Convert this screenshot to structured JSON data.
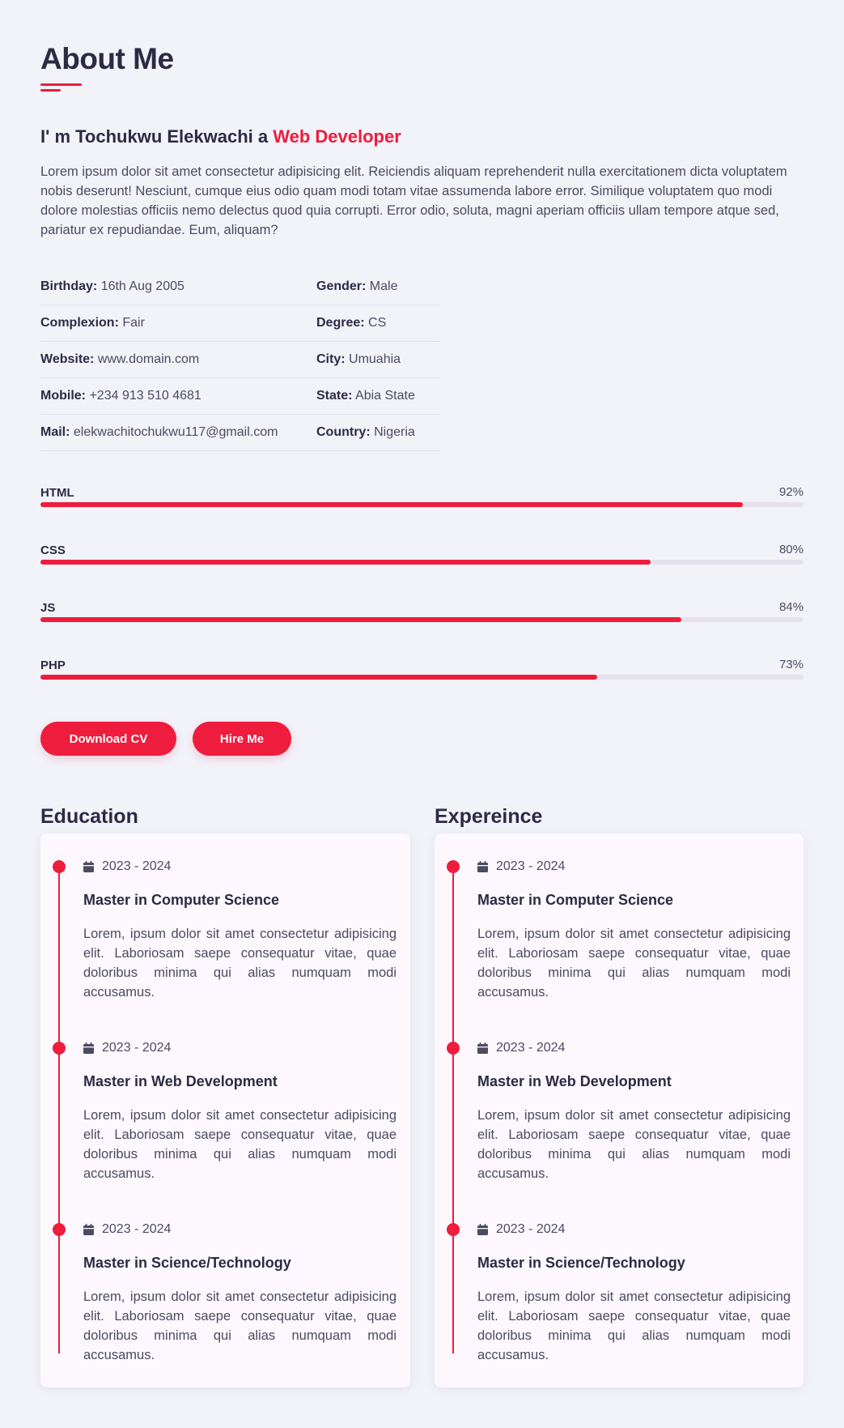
{
  "about": {
    "title": "About Me",
    "intro_prefix": "I' m Tochukwu Elekwachi a ",
    "intro_role": "Web Developer",
    "paragraph": "Lorem ipsum dolor sit amet consectetur adipisicing elit. Reiciendis aliquam reprehenderit nulla exercitationem dicta voluptatem nobis deserunt! Nesciunt, cumque eius odio quam modi totam vitae assumenda labore error. Similique voluptatem quo modi dolore molestias officiis nemo delectus quod quia corrupti. Error odio, soluta, magni aperiam officiis ullam tempore atque sed, pariatur ex repudiandae. Eum, aliquam?"
  },
  "info": [
    {
      "k1": "Birthday:",
      "v1": "16th Aug 2005",
      "k2": "Gender:",
      "v2": "Male"
    },
    {
      "k1": "Complexion:",
      "v1": "Fair",
      "k2": "Degree:",
      "v2": "CS"
    },
    {
      "k1": "Website:",
      "v1": "www.domain.com",
      "k2": "City:",
      "v2": "Umuahia"
    },
    {
      "k1": "Mobile:",
      "v1": "+234 913 510 4681",
      "k2": "State:",
      "v2": "Abia State"
    },
    {
      "k1": "Mail:",
      "v1": "elekwachitochukwu117@gmail.com",
      "k2": "Country:",
      "v2": "Nigeria"
    }
  ],
  "skills": [
    {
      "name": "HTML",
      "percent_label": "92%",
      "value": 92
    },
    {
      "name": "CSS",
      "percent_label": "80%",
      "value": 80
    },
    {
      "name": "JS",
      "percent_label": "84%",
      "value": 84
    },
    {
      "name": "PHP",
      "percent_label": "73%",
      "value": 73
    }
  ],
  "buttons": {
    "download": "Download CV",
    "hire": "Hire Me"
  },
  "education": {
    "title": "Education",
    "items": [
      {
        "date": "2023 - 2024",
        "heading": "Master in Computer Science",
        "desc": "Lorem, ipsum dolor sit amet consectetur adipisicing elit. Laboriosam saepe consequatur vitae, quae doloribus minima qui alias numquam modi accusamus."
      },
      {
        "date": "2023 - 2024",
        "heading": "Master in Web Development",
        "desc": "Lorem, ipsum dolor sit amet consectetur adipisicing elit. Laboriosam saepe consequatur vitae, quae doloribus minima qui alias numquam modi accusamus."
      },
      {
        "date": "2023 - 2024",
        "heading": "Master in Science/Technology",
        "desc": "Lorem, ipsum dolor sit amet consectetur adipisicing elit. Laboriosam saepe consequatur vitae, quae doloribus minima qui alias numquam modi accusamus."
      }
    ]
  },
  "experience": {
    "title": "Expereince",
    "items": [
      {
        "date": "2023 - 2024",
        "heading": "Master in Computer Science",
        "desc": "Lorem, ipsum dolor sit amet consectetur adipisicing elit. Laboriosam saepe consequatur vitae, quae doloribus minima qui alias numquam modi accusamus."
      },
      {
        "date": "2023 - 2024",
        "heading": "Master in Web Development",
        "desc": "Lorem, ipsum dolor sit amet consectetur adipisicing elit. Laboriosam saepe consequatur vitae, quae doloribus minima qui alias numquam modi accusamus."
      },
      {
        "date": "2023 - 2024",
        "heading": "Master in Science/Technology",
        "desc": "Lorem, ipsum dolor sit amet consectetur adipisicing elit. Laboriosam saepe consequatur vitae, quae doloribus minima qui alias numquam modi accusamus."
      }
    ]
  },
  "icons": {
    "calendar": "calendar-icon"
  },
  "colors": {
    "accent": "#ee1c3d",
    "text": "#2b2b44",
    "background": "#f2f2f9"
  }
}
